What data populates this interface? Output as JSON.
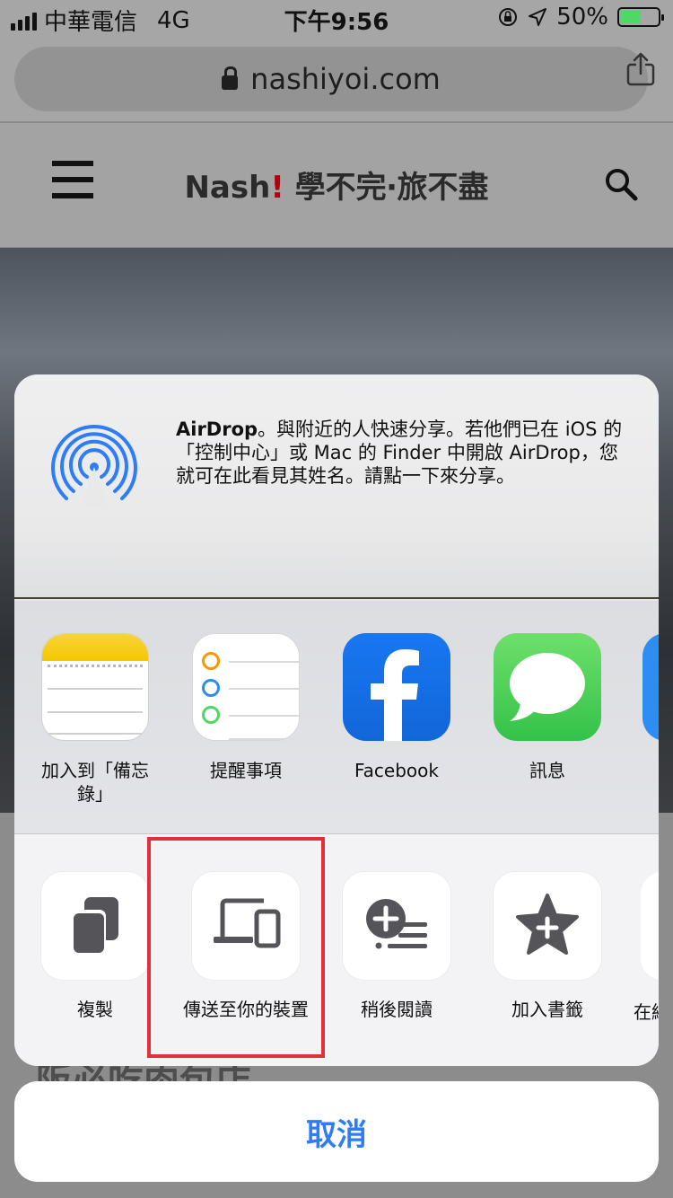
{
  "status_bar": {
    "carrier": "中華電信",
    "network": "4G",
    "time": "下午9:56",
    "battery": "50%"
  },
  "browser": {
    "url": "nashiyoi.com"
  },
  "site": {
    "title_main": "Nash",
    "title_bang": "!",
    "title_sub": " 學不完‧旅不盡",
    "behind_text": "阪必吃肉包店"
  },
  "share_sheet": {
    "airdrop_title": "AirDrop",
    "airdrop_text": "。與附近的人快速分享。若他們已在 iOS 的「控制中心」或 Mac 的 Finder 中開啟 AirDrop，您就可在此看見其姓名。請點一下來分享。",
    "apps": [
      {
        "label": "加入到「備忘錄」",
        "icon": "notes-icon"
      },
      {
        "label": "提醒事項",
        "icon": "reminders-icon"
      },
      {
        "label": "Facebook",
        "icon": "facebook-icon"
      },
      {
        "label": "訊息",
        "icon": "messages-icon"
      }
    ],
    "actions": [
      {
        "label": "複製",
        "icon": "copy-icon"
      },
      {
        "label": "傳送至你的裝置",
        "icon": "devices-icon"
      },
      {
        "label": "稍後閱讀",
        "icon": "reading-list-icon"
      },
      {
        "label": "加入書籤",
        "icon": "bookmark-star-icon"
      },
      {
        "label": "在網",
        "icon": "partial-action"
      }
    ],
    "cancel_label": "取消"
  },
  "colors": {
    "accent_blue": "#2e7cf6",
    "highlight_red": "#e0303a",
    "airdrop_blue": "#2e7cf6"
  }
}
